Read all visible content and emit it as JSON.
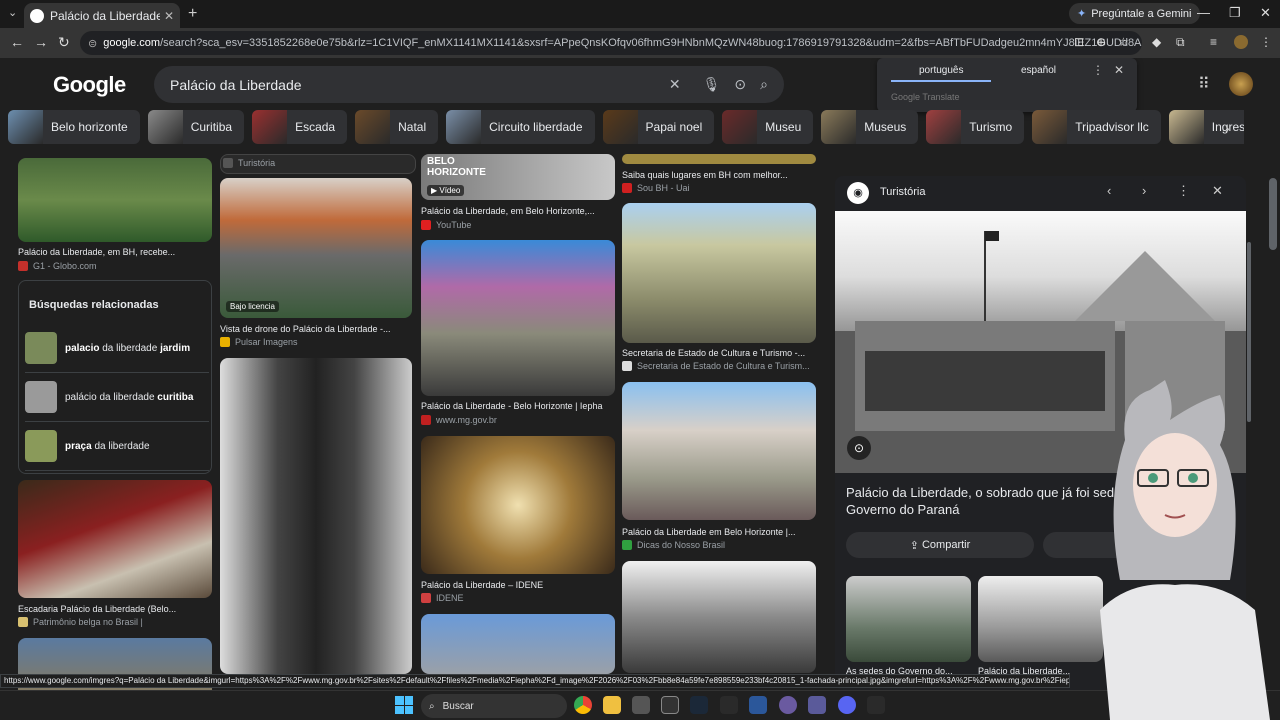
{
  "browser": {
    "tab_title": "Palácio da Liberdade - Buscar c",
    "tab_close": "✕",
    "new_tab": "+",
    "tab_menu": "⌄",
    "gemini_label": "Pregúntale a Gemini",
    "url_domain": "google.com",
    "url_rest": "/search?sca_esv=3351852268e0e75b&rlz=1C1VIQF_enMX1141MX1141&sxsrf=APpeQnsKOfqv06fhmG9HNbnMQzWN48buog:1786919791328&udm=2&fbs=ABfTbFUDadgeu2mn4mYJ8iEZ1GUDd8ABuXxNzQEi57SWOuu..."
  },
  "google": {
    "logo": "Google",
    "query": "Palácio da Liberdade",
    "translate": {
      "lang_active": "português",
      "lang_other": "español",
      "brand": "Google Translate"
    },
    "chips": [
      {
        "label": "Belo horizonte",
        "color": "#6d8fb0"
      },
      {
        "label": "Curitiba",
        "color": "#8a8a8a"
      },
      {
        "label": "Escada",
        "color": "#9a3030"
      },
      {
        "label": "Natal",
        "color": "#6a4a2a"
      },
      {
        "label": "Circuito liberdade",
        "color": "#7a8fa8"
      },
      {
        "label": "Papai noel",
        "color": "#5a3a1a"
      },
      {
        "label": "Museu",
        "color": "#6a2a2a"
      },
      {
        "label": "Museus",
        "color": "#8a7a5a"
      },
      {
        "label": "Turismo",
        "color": "#a04040"
      },
      {
        "label": "Tripadvisor llc",
        "color": "#7a5a3a"
      },
      {
        "label": "Ingresso",
        "color": "#c8b890"
      }
    ],
    "col1": {
      "top_caption": "Palácio da Liberdade, em BH, recebe...",
      "top_source": "G1 - Globo.com",
      "related_title": "Búsquedas relacionadas",
      "related": [
        {
          "bold": "palacio",
          "mid": " da liberdade ",
          "bold2": "jardim"
        },
        {
          "bold": "",
          "mid": "palácio da liberdade ",
          "bold2": "curitiba"
        },
        {
          "bold": "praça",
          "mid": " da liberdade",
          "bold2": ""
        }
      ],
      "stairs_caption": "Escadaria Palácio da Liberdade (Belo...",
      "stairs_source": "Patrimônio belga no Brasil |"
    },
    "col2": {
      "top_source": "Turistória",
      "drone_badge": "Bajo licencia",
      "drone_caption": "Vista de drone do Palácio da Liberdade -...",
      "drone_source": "Pulsar Imagens"
    },
    "col3": {
      "video_text": "BELO HORIZONTE",
      "video_badge": "Vídeo",
      "yt_caption": "Palácio da Liberdade, em Belo Horizonte,...",
      "yt_source": "YouTube",
      "iepha_caption": "Palácio da Liberdade - Belo Horizonte | Iepha",
      "iepha_source": "www.mg.gov.br",
      "idene_caption": "Palácio da Liberdade – IDENE",
      "idene_source": "IDENE"
    },
    "col4": {
      "bh_caption": "Saiba quais lugares em BH com melhor...",
      "bh_source": "Sou BH - Uai",
      "sec_caption": "Secretaria de Estado de Cultura e Turismo -...",
      "sec_source": "Secretaria de Estado de Cultura e Turism...",
      "dicas_caption": "Palácio da Liberdade em Belo Horizonte |...",
      "dicas_source": "Dicas do Nosso Brasil"
    },
    "panel": {
      "source": "Turistória",
      "title": "Palácio da Liberdade, o sobrado que já foi sede do Governo do Paraná",
      "share": "Compartir",
      "thumb1_caption": "As sedes do Governo do...",
      "thumb2_caption": "Palácio da Liberdade..."
    }
  },
  "status_url": "https://www.google.com/imgres?q=Palácio da Liberdade&imgurl=https%3A%2F%2Fwww.mg.gov.br%2Fsites%2Fdefault%2Ffiles%2Fmedia%2Fiepha%2Fd_image%2F2026%2F03%2Fbb8e84a59fe7e898559e233bf4c20815_1-fachada-principal.jpg&imgrefurl=https%3A%2F%2Fwww.mg.gov.br%2Fiepha%2...",
  "taskbar": {
    "search": "Buscar"
  }
}
